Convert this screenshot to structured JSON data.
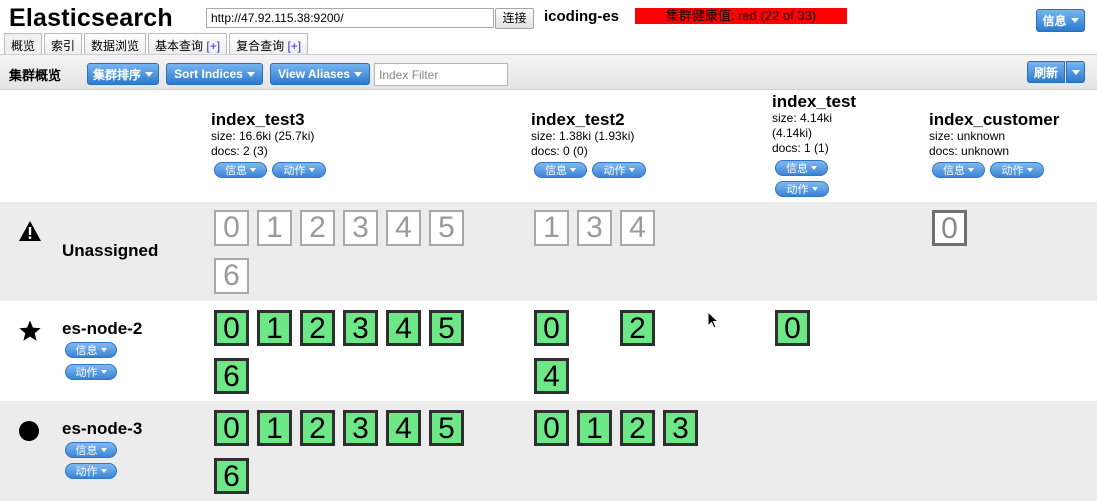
{
  "header": {
    "title": "Elasticsearch",
    "url": "http://47.92.115.38:9200/",
    "connect_label": "连接",
    "cluster_name": "icoding-es",
    "health_text": "集群健康值: red (22 of 33)",
    "info_label": "信息",
    "health_color": "#ff0000"
  },
  "tabs": [
    {
      "label": "概览",
      "plus": ""
    },
    {
      "label": "索引",
      "plus": ""
    },
    {
      "label": "数据浏览",
      "plus": ""
    },
    {
      "label": "基本查询",
      "plus": "[+]"
    },
    {
      "label": "复合查询",
      "plus": "[+]"
    }
  ],
  "toolbar": {
    "title": "集群概览",
    "sort_cluster_label": "集群排序",
    "sort_indices_label": "Sort Indices",
    "view_aliases_label": "View Aliases",
    "filter_placeholder": "Index Filter",
    "refresh_label": "刷新"
  },
  "indices": [
    {
      "name": "index_test3",
      "size": "size: 16.6ki (25.7ki)",
      "docs": "docs: 2 (3)",
      "info_label": "信息",
      "action_label": "动作"
    },
    {
      "name": "index_test2",
      "size": "size: 1.38ki (1.93ki)",
      "docs": "docs: 0 (0)",
      "info_label": "信息",
      "action_label": "动作"
    },
    {
      "name": "index_test",
      "size": "size: 4.14ki",
      "size_extra": "(4.14ki)",
      "docs": "docs: 1 (1)",
      "info_label": "信息",
      "action_label": "动作"
    },
    {
      "name": "index_customer",
      "size": "size: unknown",
      "docs": "docs: unknown",
      "info_label": "信息",
      "action_label": "动作"
    }
  ],
  "nodes": [
    {
      "name": "Unassigned",
      "icon": "warning-icon"
    },
    {
      "name": "es-node-2",
      "icon": "star-icon",
      "info_label": "信息",
      "action_label": "动作"
    },
    {
      "name": "es-node-3",
      "icon": "circle-icon",
      "info_label": "信息",
      "action_label": "动作"
    }
  ],
  "shards": {
    "unassigned": {
      "index_test3": [
        "0",
        "1",
        "2",
        "3",
        "4",
        "5",
        "6"
      ],
      "index_test2": [
        "1",
        "3",
        "4"
      ],
      "index_customer": [
        "0"
      ]
    },
    "es_node_2": {
      "index_test3": [
        "0",
        "1",
        "2",
        "3",
        "4",
        "5",
        "6"
      ],
      "index_test2": [
        "0",
        "2",
        "4"
      ],
      "index_test": [
        "0"
      ]
    },
    "es_node_3": {
      "index_test3": [
        "0",
        "1",
        "2",
        "3",
        "4",
        "5",
        "6"
      ],
      "index_test2": [
        "0",
        "1",
        "2",
        "3"
      ]
    }
  },
  "colors": {
    "assigned_shard": "#6ee887",
    "primary_blue": "#2d7ad0"
  }
}
